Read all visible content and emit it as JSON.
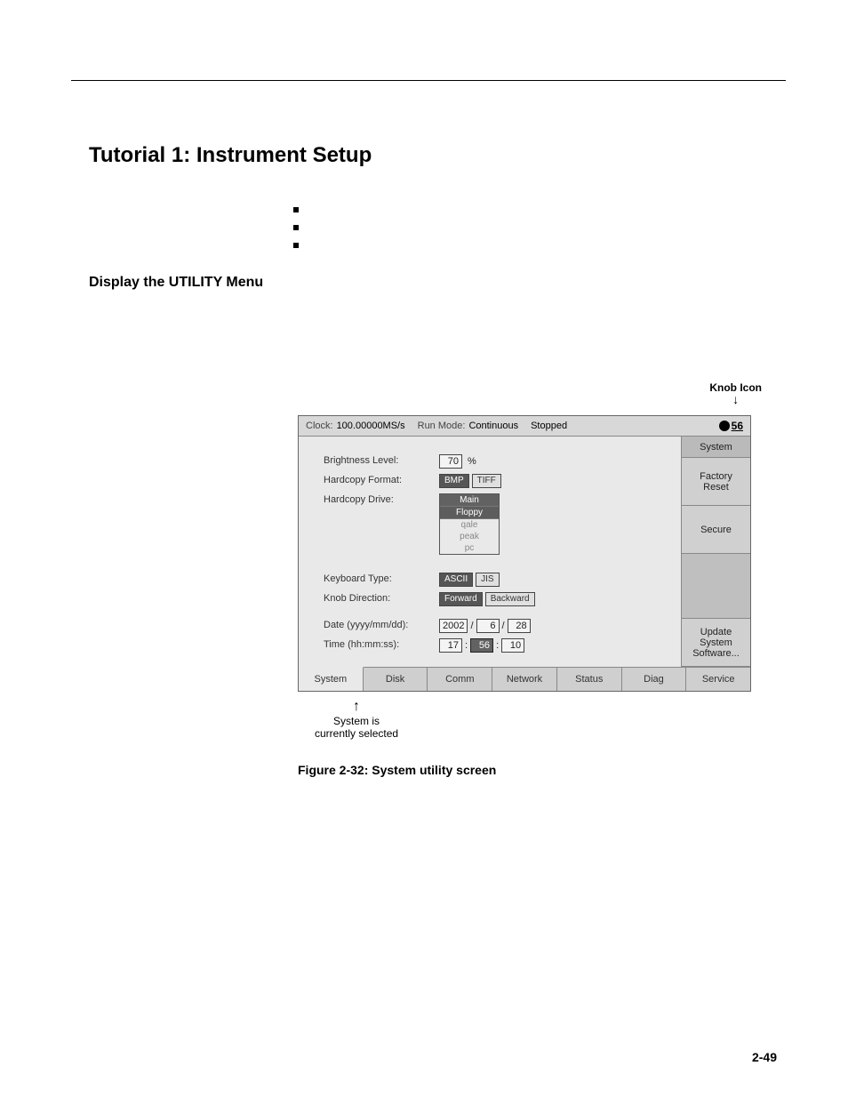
{
  "headings": {
    "main": "Tutorial 1: Instrument Setup",
    "sub": "Display the UTILITY Menu"
  },
  "callouts": {
    "knob_icon": "Knob Icon",
    "system_selected_line1": "System is",
    "system_selected_line2": "currently selected"
  },
  "screen": {
    "titlebar": {
      "clock_label": "Clock:",
      "clock_value": "100.00000MS/s",
      "runmode_label": "Run Mode:",
      "runmode_value": "Continuous",
      "status": "Stopped",
      "knob_value": "56"
    },
    "settings": {
      "brightness_label": "Brightness Level:",
      "brightness_value": "70",
      "percent": "%",
      "hc_format_label": "Hardcopy Format:",
      "hc_format_opts": [
        "BMP",
        "TIFF"
      ],
      "hc_drive_label": "Hardcopy Drive:",
      "drives": {
        "main": "Main",
        "floppy": "Floppy",
        "qale": "qale",
        "peak": "peak",
        "pc": "pc"
      },
      "kbd_label": "Keyboard Type:",
      "kbd_opts": [
        "ASCII",
        "JIS"
      ],
      "knobdir_label": "Knob Direction:",
      "knobdir_opts": [
        "Forward",
        "Backward"
      ],
      "date_label": "Date (yyyy/mm/dd):",
      "date": {
        "y": "2002",
        "m": "6",
        "d": "28"
      },
      "time_label": "Time (hh:mm:ss):",
      "time": {
        "h": "17",
        "m": "56",
        "s": "10"
      },
      "slash": "/",
      "colon": ":"
    },
    "side": {
      "system": "System",
      "factory_reset": "Factory\nReset",
      "secure": "Secure",
      "update": "Update\nSystem\nSoftware..."
    },
    "tabs": [
      "System",
      "Disk",
      "Comm",
      "Network",
      "Status",
      "Diag",
      "Service"
    ]
  },
  "figure_caption": "Figure 2-32: System utility screen",
  "page_number": "2-49"
}
